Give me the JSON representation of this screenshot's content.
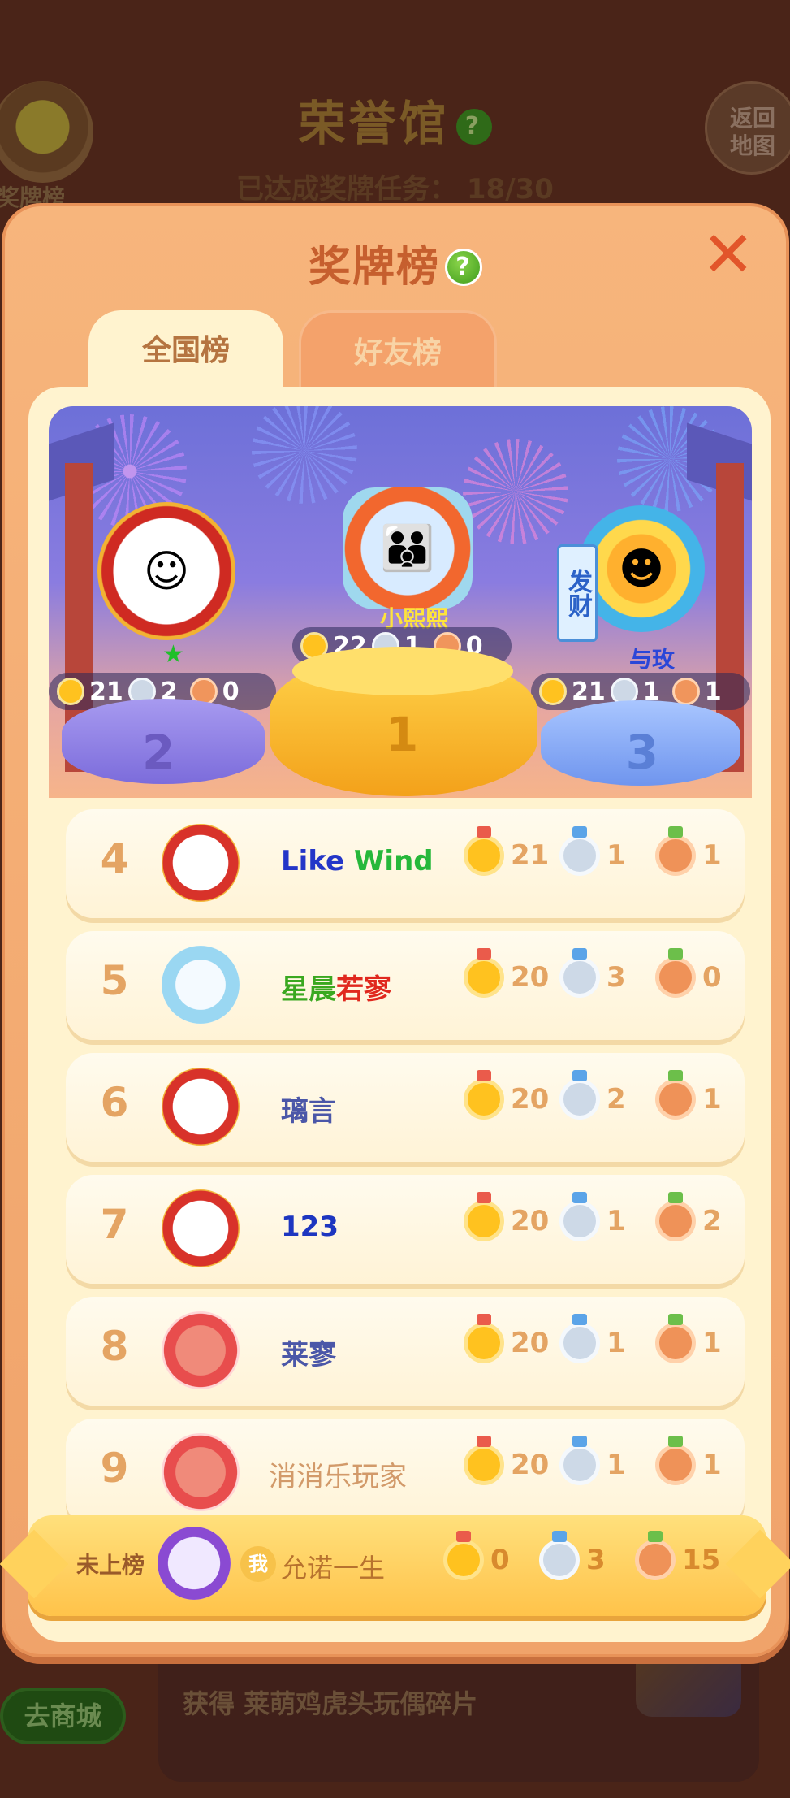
{
  "background": {
    "title": "荣誉馆",
    "subtitle": "已达成奖牌任务： 18/30",
    "badge_label": "奖牌榜",
    "back_label": "返回地图",
    "shop_label": "去商城",
    "reward_text": "获得 莱萌鸡虎头玩偶碎片"
  },
  "modal": {
    "title": "奖牌榜",
    "help": "?",
    "close": "✕",
    "tabs": [
      {
        "label": "全国榜",
        "active": true
      },
      {
        "label": "好友榜",
        "active": false
      }
    ]
  },
  "podium": {
    "first": {
      "rank": "1",
      "name": "小熙熙",
      "gold": "22",
      "silver": "1",
      "bronze": "0"
    },
    "second": {
      "rank": "2",
      "name": "",
      "gold": "21",
      "silver": "2",
      "bronze": "0"
    },
    "third": {
      "rank": "3",
      "name": "与玫",
      "gold": "21",
      "silver": "1",
      "bronze": "1",
      "tag": "发财"
    }
  },
  "rows": [
    {
      "rank": "4",
      "name_a": "Like",
      "name_b": "Wind",
      "gold": "21",
      "silver": "1",
      "bronze": "1"
    },
    {
      "rank": "5",
      "name_a": "星晨",
      "name_b": "若寥",
      "gold": "20",
      "silver": "3",
      "bronze": "0"
    },
    {
      "rank": "6",
      "name": "璃言",
      "gold": "20",
      "silver": "2",
      "bronze": "1"
    },
    {
      "rank": "7",
      "name": "123",
      "gold": "20",
      "silver": "1",
      "bronze": "2"
    },
    {
      "rank": "8",
      "name": "莱寥",
      "gold": "20",
      "silver": "1",
      "bronze": "1"
    },
    {
      "rank": "9",
      "name": "消消乐玩家",
      "gold": "20",
      "silver": "1",
      "bronze": "1"
    }
  ],
  "me": {
    "label": "未上榜",
    "tag": "我",
    "name": "允诺一生",
    "gold": "0",
    "silver": "3",
    "bronze": "15"
  },
  "colors": {
    "gold": "#ffc21f",
    "silver": "#cdd9e7",
    "bronze": "#ef9258",
    "accent": "#c65f2e"
  }
}
